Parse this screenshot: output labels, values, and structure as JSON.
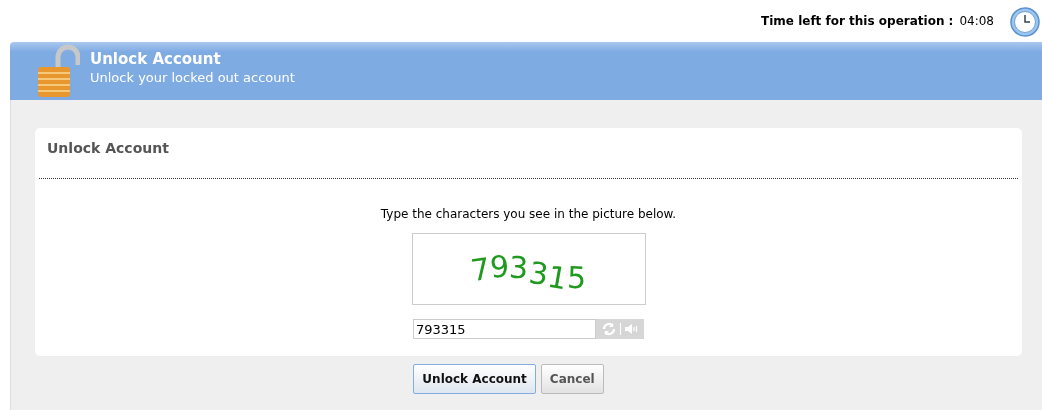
{
  "timer": {
    "label": "Time left for this operation :",
    "value": "04:08"
  },
  "header": {
    "title": "Unlock Account",
    "subtitle": "Unlock your locked out account"
  },
  "card": {
    "title": "Unlock Account",
    "instruction": "Type the characters you see in the picture below.",
    "captcha_text": "793315",
    "answer": {
      "value": "793315"
    }
  },
  "buttons": [
    {
      "label": "Unlock Account",
      "kind": "primary"
    },
    {
      "label": "Cancel",
      "kind": "secondary"
    }
  ]
}
